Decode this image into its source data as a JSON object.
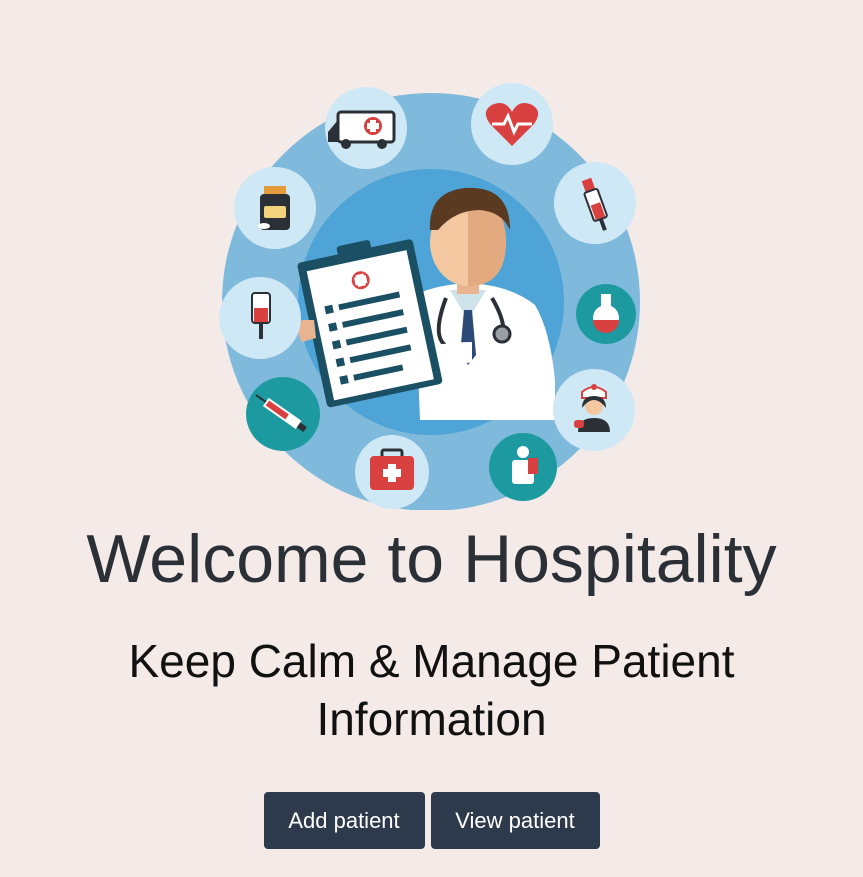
{
  "hero": {
    "illustration": "doctor-with-clipboard-medical-icons",
    "icons": [
      "ambulance-icon",
      "heart-rate-icon",
      "dropper-icon",
      "flask-icon",
      "nurse-icon",
      "injured-patient-icon",
      "first-aid-kit-icon",
      "syringe-icon",
      "iv-bag-icon",
      "pill-bottle-icon"
    ]
  },
  "main": {
    "title": "Welcome to Hospitality",
    "subtitle": "Keep Calm & Manage Patient Information"
  },
  "actions": {
    "add_label": "Add patient",
    "view_label": "View patient"
  },
  "colors": {
    "background": "#f4ebe8",
    "button": "#2c3a4c",
    "button_text": "#ffffff",
    "title": "#2b2f36",
    "ring_outer": "#7fb9dc",
    "ring_inner": "#4ea4d6",
    "icon_bg": "#cfe8f6",
    "icon_teal": "#1d9aa0"
  }
}
